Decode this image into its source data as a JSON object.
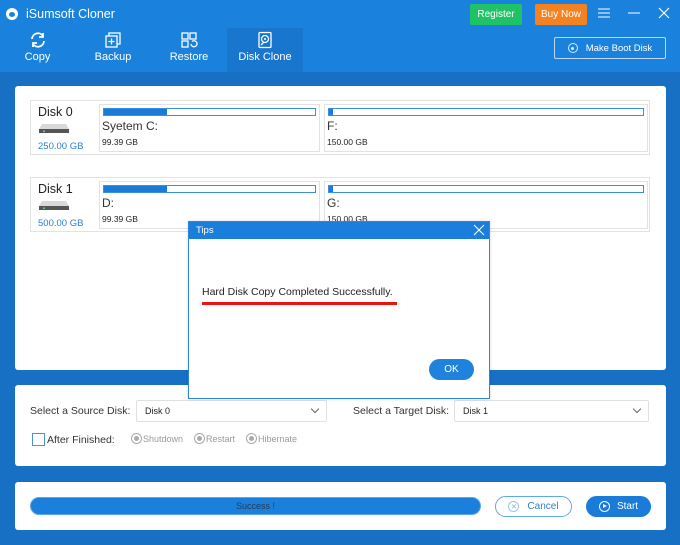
{
  "app": {
    "title": "iSumsoft Cloner",
    "register_label": "Register",
    "buy_label": "Buy Now",
    "colors": {
      "header": "#1a82dc",
      "register": "#20c267",
      "buy": "#f58220",
      "accent": "#1a7cd8"
    }
  },
  "nav": {
    "items": [
      {
        "label": "Copy",
        "icon": "sync-icon",
        "active": false
      },
      {
        "label": "Backup",
        "icon": "backup-icon",
        "active": false
      },
      {
        "label": "Restore",
        "icon": "restore-icon",
        "active": false
      },
      {
        "label": "Disk Clone",
        "icon": "disk-clone-icon",
        "active": true
      }
    ],
    "boot_label": "Make Boot Disk"
  },
  "disks": [
    {
      "name": "Disk 0",
      "size": "250.00 GB",
      "partitions": [
        {
          "label": "Syetem C:",
          "size": "99.39 GB",
          "used_fraction": 0.3
        },
        {
          "label": "F:",
          "size": "150.00 GB",
          "used_fraction": 0.01
        }
      ]
    },
    {
      "name": "Disk 1",
      "size": "500.00 GB",
      "partitions": [
        {
          "label": "D:",
          "size": "99.39 GB",
          "used_fraction": 0.3
        },
        {
          "label": "G:",
          "size": "150.00 GB",
          "used_fraction": 0.01
        }
      ]
    }
  ],
  "options": {
    "source_label": "Select a Source Disk:",
    "source_value": "Disk 0",
    "target_label": "Select a Target Disk:",
    "target_value": "Disk 1",
    "after_finished_label": "After Finished:",
    "after_finished_checked": false,
    "radios": [
      "Shutdown",
      "Restart",
      "Hibernate"
    ]
  },
  "progress": {
    "status_text": "Success !",
    "percent": 100,
    "cancel_label": "Cancel",
    "start_label": "Start"
  },
  "dialog": {
    "title": "Tips",
    "message": "Hard Disk Copy Completed Successfully.",
    "ok_label": "OK"
  }
}
